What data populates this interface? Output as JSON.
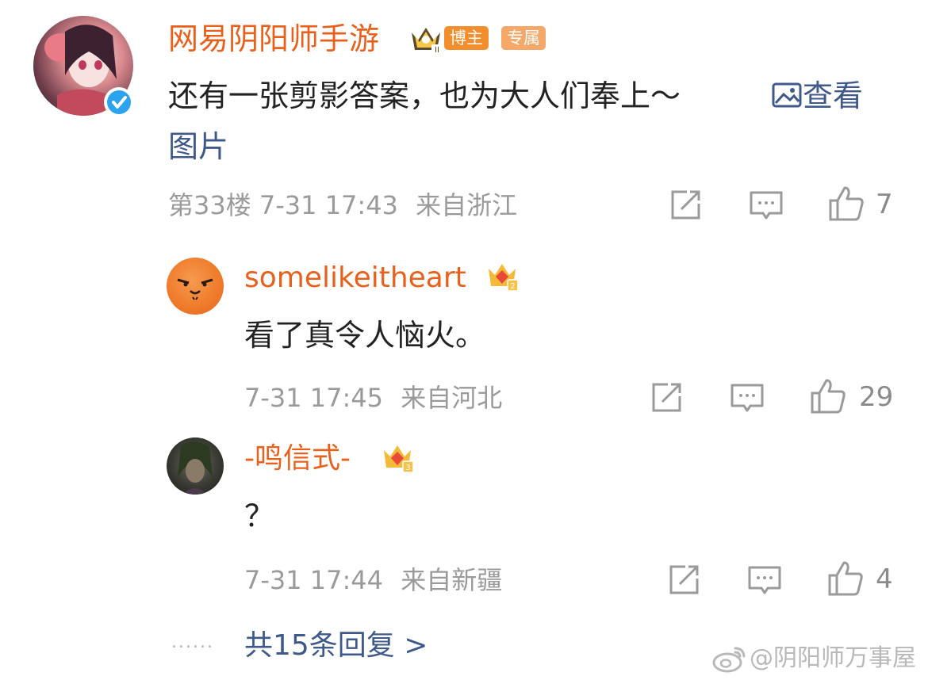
{
  "colors": {
    "name": "#e8611c",
    "link": "#3f5a8a",
    "meta": "#9a9a9a",
    "icon": "#9a9a9a"
  },
  "main_comment": {
    "author": "网易阴阳师手游",
    "verified": true,
    "badges": [
      "博主",
      "专属"
    ],
    "text_line1": "还有一张剪影答案，也为大人们奉上～",
    "view_image_label": "查看",
    "text_line2": "图片",
    "floor_time": "第33楼 7-31 17:43",
    "location": "来自浙江",
    "like_count": "7"
  },
  "replies": [
    {
      "author": "somelikeitheart",
      "crown_level": "2",
      "text": "看了真令人恼火。",
      "time": "7-31 17:45",
      "location": "来自河北",
      "like_count": "29"
    },
    {
      "author": "-鸣信式-",
      "crown_level": "3",
      "text": "？",
      "time": "7-31 17:44",
      "location": "来自新疆",
      "like_count": "4"
    }
  ],
  "more_replies": {
    "dots": "......",
    "label": "共15条回复 >"
  },
  "watermark": "@阴阳师万事屋",
  "icons": [
    "verified-icon",
    "crown-icon",
    "share-icon",
    "comment-icon",
    "like-icon",
    "image-icon",
    "weibo-logo-icon"
  ]
}
